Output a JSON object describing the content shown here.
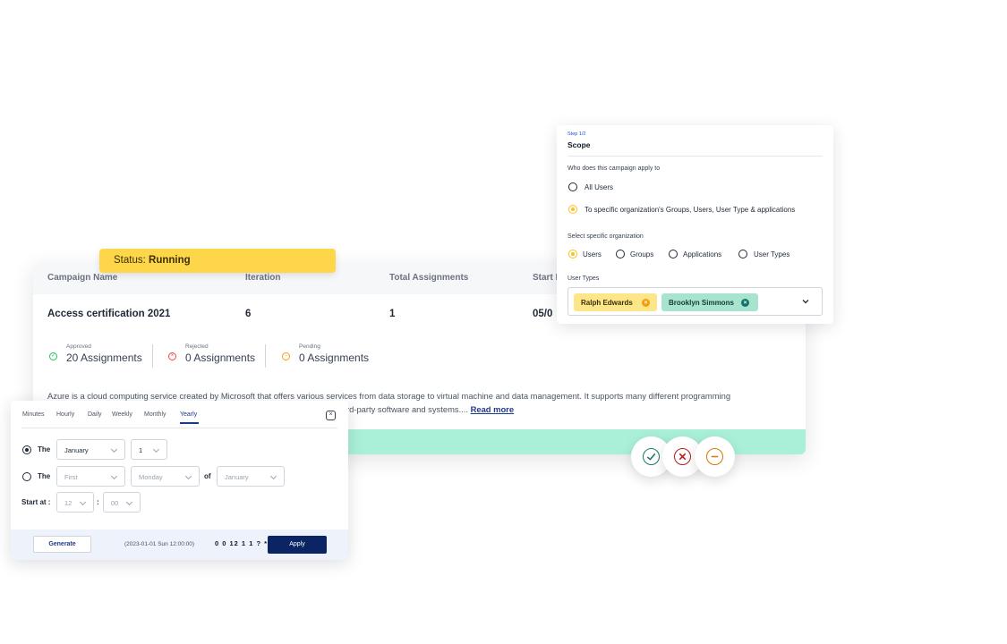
{
  "status_badge": {
    "label": "Status:",
    "value": "Running"
  },
  "campaign": {
    "headers": {
      "name": "Campaign Name",
      "iteration": "Iteration",
      "total": "Total Assignments",
      "start": "Start D"
    },
    "row": {
      "name": "Access certification 2021",
      "iteration": "6",
      "total": "1",
      "start": "05/0"
    },
    "stats": [
      {
        "label": "Approved",
        "value": "20 Assignments",
        "color": "#22c55e",
        "icon": "check-circle-icon"
      },
      {
        "label": "Rejected",
        "value": "0 Assignments",
        "color": "#ef4444",
        "icon": "x-circle-icon"
      },
      {
        "label": "Pending",
        "value": "0 Assignments",
        "color": "#f59e0b",
        "icon": "minus-circle-icon"
      }
    ],
    "description_line1": "Azure is a cloud computing service created by Microsoft that offers various services from data storage to virtual machine and data management. It supports many different programming",
    "description_line2": "rd-party software and systems....",
    "read_more": "Read more"
  },
  "scope": {
    "step": "Step 1/2",
    "title": "Scope",
    "question": "Who does this campaign apply to",
    "apply_options": [
      "All Users",
      "To specific organization's Groups, Users, User Type & applications"
    ],
    "org_label": "Select specific organization",
    "org_options": [
      "Users",
      "Groups",
      "Applications",
      "User Types"
    ],
    "user_types_label": "User Types",
    "chips": [
      {
        "label": "Ralph Edwards",
        "bg": "#fde68a",
        "x_color": "#f59e0b"
      },
      {
        "label": "Brooklyn Simmons",
        "bg": "#a7e3cf",
        "x_color": "#0f766e"
      }
    ]
  },
  "actions": [
    {
      "name": "approve-action",
      "icon": "check-icon",
      "color": "#1f7a6b"
    },
    {
      "name": "reject-action",
      "icon": "x-icon",
      "color": "#b91c1c"
    },
    {
      "name": "pending-action",
      "icon": "minus-icon",
      "color": "#d97706"
    }
  ],
  "scheduler": {
    "tabs": [
      "Minutes",
      "Hourly",
      "Daily",
      "Weekly",
      "Monthly",
      "Yearly"
    ],
    "active_tab": "Yearly",
    "row1": {
      "label": "The",
      "month": "January",
      "day": "1"
    },
    "row2": {
      "label": "The",
      "ordinal": "First",
      "weekday": "Monday",
      "of": "of",
      "month": "January"
    },
    "start": {
      "label": "Start at :",
      "hour": "12",
      "sep": ":",
      "minute": "00"
    },
    "generate": "Generate",
    "preview": "(2023-01-01 Sun 12:00:00)",
    "cron": "0 0 12 1 1 ? *",
    "apply": "Apply"
  }
}
